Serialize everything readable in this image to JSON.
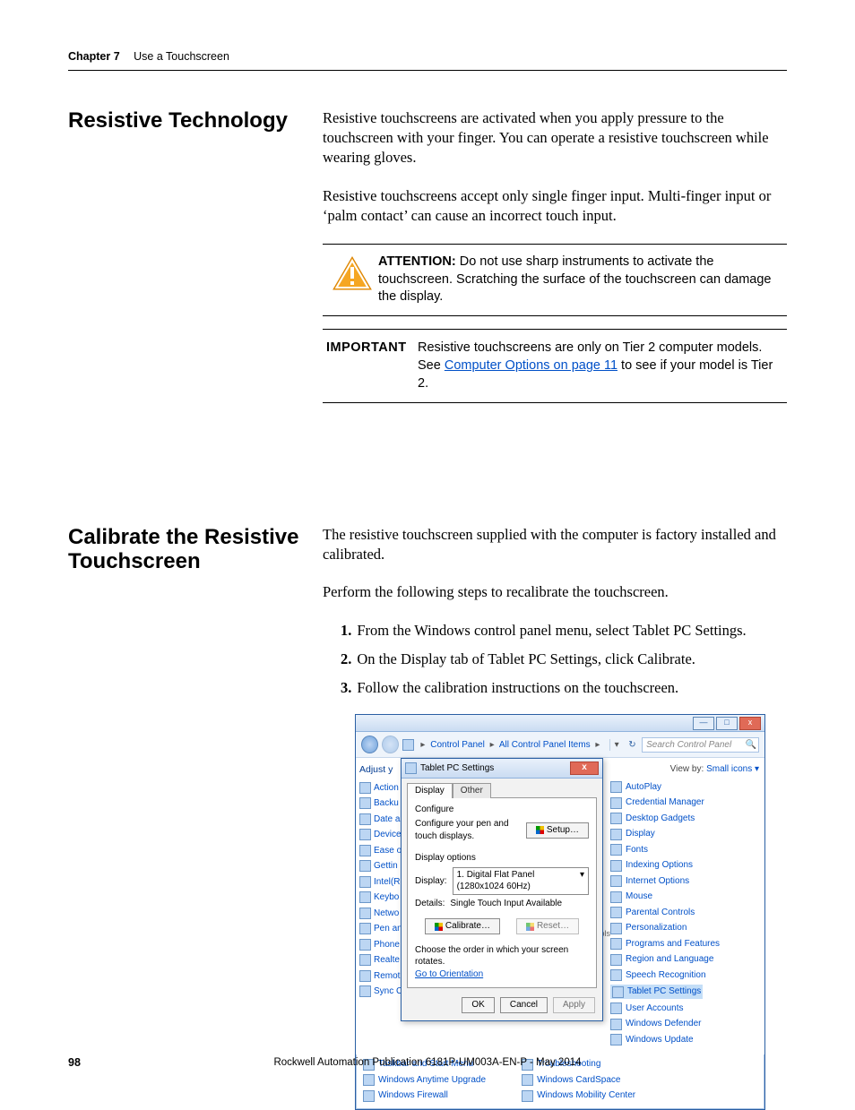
{
  "header": {
    "chapter": "Chapter 7",
    "title": "Use a Touchscreen"
  },
  "section1": {
    "heading": "Resistive Technology",
    "para1": "Resistive touchscreens are activated when you apply pressure to the touchscreen with your finger. You can operate a resistive touchscreen while wearing gloves.",
    "para2": "Resistive touchscreens accept only single finger input. Multi-finger input or ‘palm contact’ can cause an incorrect touch input.",
    "attention_label": "ATTENTION:",
    "attention_text": " Do not use sharp instruments to activate the touchscreen. Scratching the surface of the touchscreen can damage the display.",
    "important_label": "IMPORTANT",
    "important_pre": "Resistive touchscreens are only on Tier 2 computer models. See ",
    "important_link": "Computer Options on page 11",
    "important_post": " to see if your model is Tier 2."
  },
  "section2": {
    "heading": "Calibrate the Resistive Touchscreen",
    "para1": "The resistive touchscreen supplied with the computer is factory installed and calibrated.",
    "para2": "Perform the following steps to recalibrate the touchscreen.",
    "steps": [
      "From the Windows control panel menu, select Tablet PC Settings.",
      "On the Display tab of Tablet PC Settings, click Calibrate.",
      "Follow the calibration instructions on the touchscreen."
    ]
  },
  "screenshot": {
    "breadcrumb": {
      "root": "Control Panel",
      "level2": "All Control Panel Items"
    },
    "search_placeholder": "Search Control Panel",
    "viewby_label": "View by:",
    "viewby_value": "Small icons ▾",
    "left_header": "Adjust y",
    "left_items": [
      "Action",
      "Backu",
      "Date a",
      "Device",
      "Ease o",
      "Gettin",
      "Intel(R",
      "Keybo",
      "Netwo",
      "Pen an",
      "Phone",
      "Realte",
      "Remot",
      "Sync C"
    ],
    "right_items": [
      "AutoPlay",
      "Credential Manager",
      "Desktop Gadgets",
      "Display",
      "Fonts",
      "Indexing Options",
      "Internet Options",
      "Mouse",
      "Parental Controls",
      "Personalization",
      "Programs and Features",
      "Region and Language",
      "Speech Recognition",
      "Tablet PC Settings",
      "User Accounts",
      "Windows Defender",
      "Windows Update"
    ],
    "bottom_left": [
      "Taskbar and Start Menu",
      "Windows Anytime Upgrade",
      "Windows Firewall"
    ],
    "bottom_mid": [
      "Troubleshooting",
      "Windows CardSpace",
      "Windows Mobility Center"
    ],
    "dialog": {
      "title": "Tablet PC Settings",
      "tab1": "Display",
      "tab2": "Other",
      "configure_head": "Configure",
      "configure_text": "Configure your pen and touch displays.",
      "setup_btn": "Setup…",
      "disp_opts": "Display options",
      "display_label": "Display:",
      "display_value": "1. Digital Flat Panel (1280x1024 60Hz)",
      "details_label": "Details:",
      "details_value": "Single Touch Input Available",
      "calibrate_btn": "Calibrate…",
      "reset_btn": "Reset…",
      "rotate_text": "Choose the order in which your screen rotates.",
      "rotate_link": "Go to Orientation",
      "ok": "OK",
      "cancel": "Cancel",
      "apply": "Apply"
    },
    "ols_text": "ols"
  },
  "footer": {
    "page": "98",
    "pub": "Rockwell Automation Publication 6181P-UM003A-EN-P - May 2014"
  }
}
